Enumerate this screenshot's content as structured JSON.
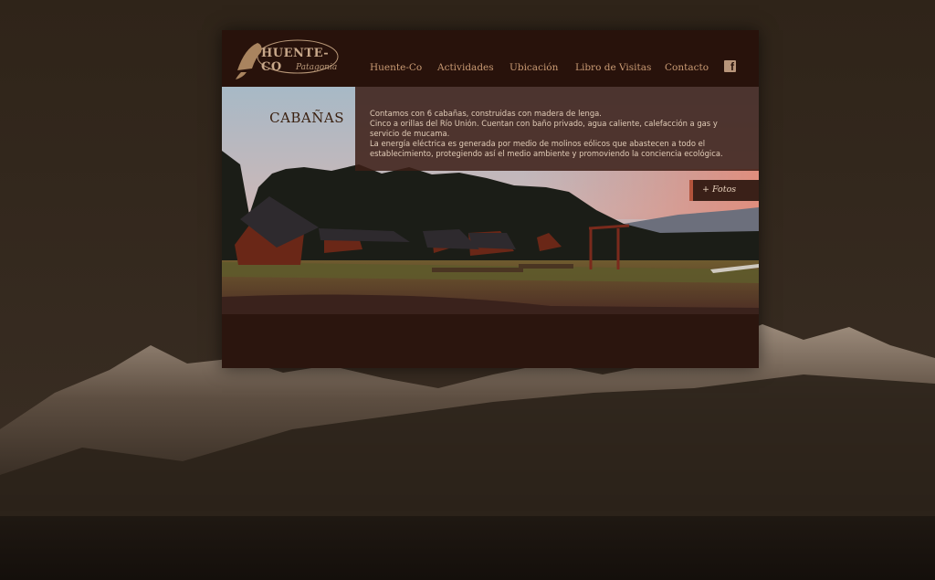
{
  "header": {
    "logo_text": "HUENTE-CO",
    "logo_sub": "Patagonia",
    "nav": [
      {
        "label": "Huente-Co"
      },
      {
        "label": "Actividades"
      },
      {
        "label": "Ubicación"
      },
      {
        "label": "Libro de Visitas"
      },
      {
        "label": "Contacto"
      }
    ],
    "facebook_icon": "facebook-icon"
  },
  "section": {
    "title": "CABAÑAS",
    "description": [
      "Contamos con 6 cabañas, construidas con madera de lenga.",
      "Cinco a orillas del Río Unión. Cuentan con baño privado, agua caliente, calefacción a gas y servicio de mucama.",
      "La energía eléctrica es generada por medio de molinos eólicos que abastecen a todo el establecimiento, protegiendo así el medio ambiente y promoviendo la conciencia ecológica."
    ],
    "photos_button": "+ Fotos"
  },
  "colors": {
    "page_bg": "#2f2419",
    "frame_bg": "#2a140d",
    "nav_text": "#c99a73",
    "accent": "#b2543c"
  }
}
